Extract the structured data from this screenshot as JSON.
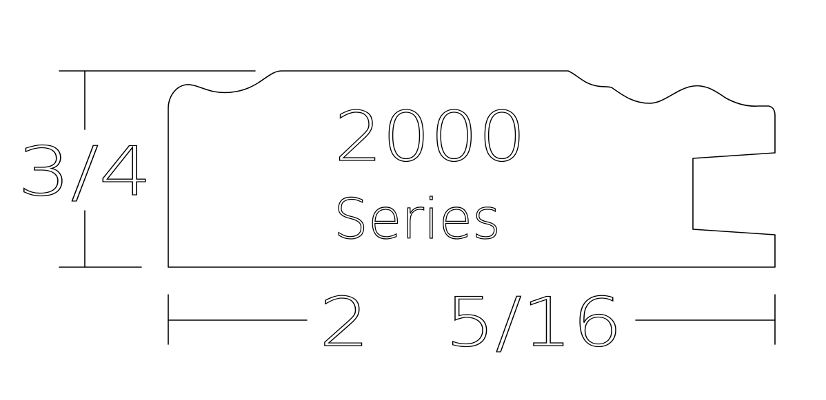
{
  "drawing": {
    "profile_name": "2000",
    "profile_series": "Series",
    "thickness_label": "3/4",
    "width_label": "2   5/16",
    "line_color": "#000000",
    "background_color": "#ffffff"
  }
}
